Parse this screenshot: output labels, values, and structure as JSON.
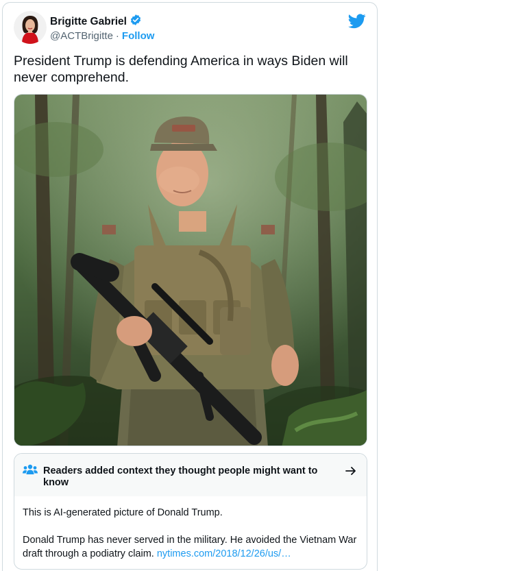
{
  "tweet": {
    "author": {
      "display_name": "Brigitte Gabriel",
      "handle": "@ACTBrigitte",
      "separator": "·",
      "follow_label": "Follow",
      "verified": true
    },
    "text": "President Trump is defending America in ways Biden will never comprehend.",
    "media": {
      "kind": "photo",
      "icon": "soldier-photo"
    }
  },
  "community_note": {
    "title": "Readers added context they thought people might want to know",
    "body_line_1": "This is AI-generated picture of Donald Trump.",
    "body_line_2": "Donald Trump has never served in the military. He avoided the Vietnam War draft through a podiatry claim.",
    "link_text": "nytimes.com/2018/12/26/us/…"
  },
  "colors": {
    "accent": "#1d9bf0",
    "text": "#0f1419",
    "secondary_text": "#536471",
    "border": "#cfd9de",
    "note_header_bg": "#f7f9f9"
  },
  "icons": {
    "verified": "verified-badge-icon",
    "brand": "twitter-bird-icon",
    "note": "people-icon",
    "note_open": "arrow-right-icon"
  }
}
